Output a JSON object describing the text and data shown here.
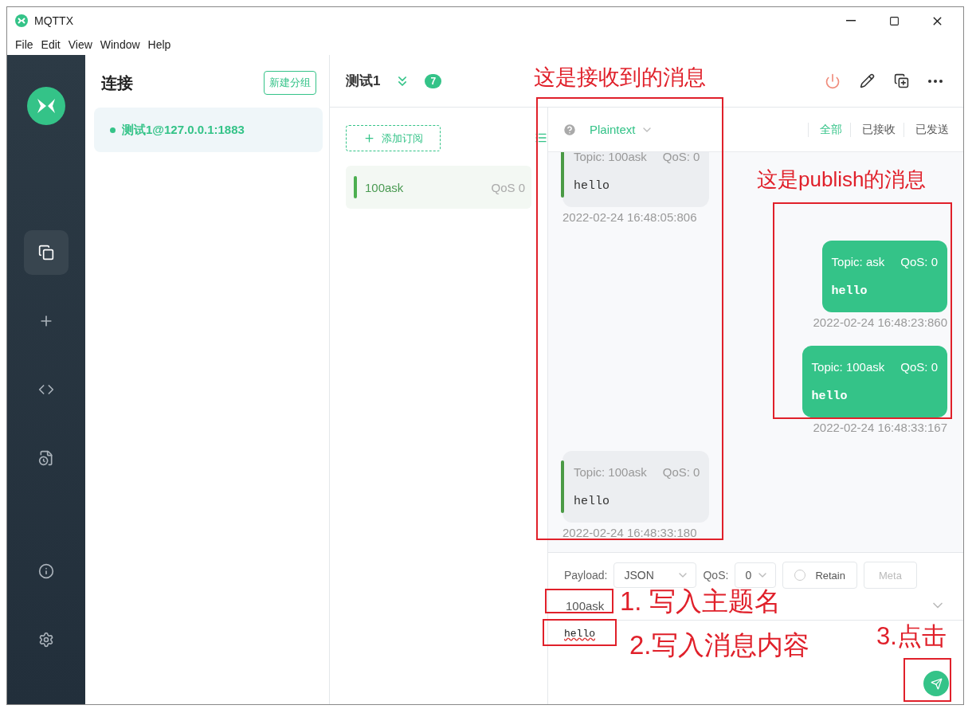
{
  "window": {
    "title": "MQTTX"
  },
  "menu": [
    "File",
    "Edit",
    "View",
    "Window",
    "Help"
  ],
  "rail": [
    {
      "kind": "connections",
      "selected": true
    },
    {
      "kind": "new",
      "selected": false
    },
    {
      "kind": "script",
      "selected": false
    },
    {
      "kind": "log",
      "selected": false
    },
    {
      "kind": "about",
      "selected": false
    },
    {
      "kind": "settings",
      "selected": false
    }
  ],
  "connections": {
    "title": "连接",
    "new_group": "新建分组",
    "items": [
      {
        "name": "测试1@127.0.0.1:1883",
        "selected": true,
        "connected": true
      }
    ]
  },
  "header": {
    "name": "测试1",
    "unread": "7"
  },
  "subscriptions": {
    "add": "添加订阅",
    "items": [
      {
        "topic": "100ask",
        "qos": "QoS 0",
        "color": "#4caf50"
      }
    ]
  },
  "messages": {
    "format": "Plaintext",
    "filters": [
      {
        "label": "全部",
        "selected": true
      },
      {
        "label": "已接收",
        "selected": false
      },
      {
        "label": "已发送",
        "selected": false
      }
    ],
    "items": [
      {
        "kind": "received",
        "topic": "Topic: 100ask",
        "qos": "QoS: 0",
        "payload": "hello",
        "time": "2022-02-24 16:48:05:806"
      },
      {
        "kind": "sent",
        "topic": "Topic: ask",
        "qos": "QoS: 0",
        "payload": "hello",
        "time": "2022-02-24 16:48:23:860"
      },
      {
        "kind": "sent",
        "topic": "Topic: 100ask",
        "qos": "QoS: 0",
        "payload": "hello",
        "time": "2022-02-24 16:48:33:167"
      },
      {
        "kind": "received",
        "topic": "Topic: 100ask",
        "qos": "QoS: 0",
        "payload": "hello",
        "time": "2022-02-24 16:48:33:180"
      }
    ]
  },
  "composer": {
    "payload_label": "Payload:",
    "payload_format": "JSON",
    "qos_label": "QoS:",
    "qos": "0",
    "retain": {
      "label": "Retain",
      "checked": false
    },
    "meta": "Meta",
    "topic": "100ask",
    "payload": "hello"
  },
  "annotations": [
    {
      "text": "这是接收到的消息"
    },
    {
      "text": "这是publish的消息"
    },
    {
      "text": "1. 写入主题名"
    },
    {
      "text": "2.写入消息内容"
    },
    {
      "text": "3.点击"
    }
  ]
}
